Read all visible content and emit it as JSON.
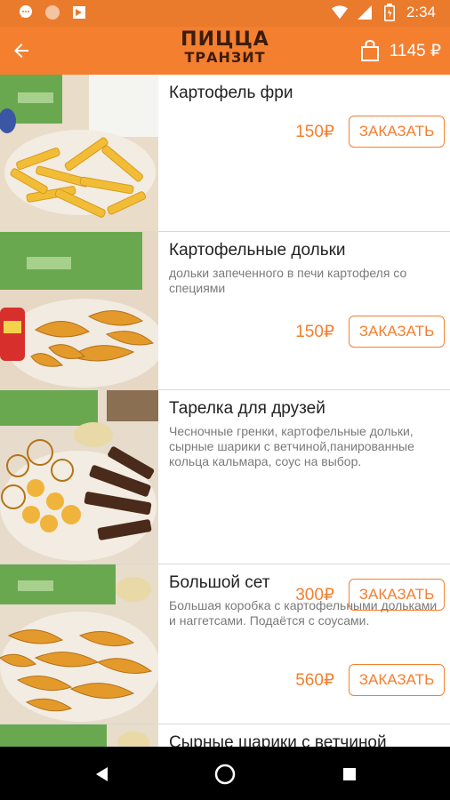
{
  "status_bar": {
    "time": "2:34",
    "left_icons": [
      "chat-icon",
      "circle-icon",
      "notification-icon"
    ],
    "right_icons": [
      "wifi-icon",
      "signal-icon",
      "battery-icon"
    ]
  },
  "app_bar": {
    "logo_line1": "ПИЦЦА",
    "logo_line2": "ТРАНЗИТ",
    "cart_total": "1145 ₽"
  },
  "colors": {
    "accent": "#f47f2f",
    "status_bar": "#ea7a2c",
    "logo_dark": "#3b1d0e"
  },
  "items": [
    {
      "title": "Картофель фри",
      "description": "",
      "price": "150₽",
      "order_label": "ЗАКАЗАТЬ"
    },
    {
      "title": "Картофельные дольки",
      "description": "дольки запеченного в печи  картофеля со специями",
      "price": "150₽",
      "order_label": "ЗАКАЗАТЬ"
    },
    {
      "title": "Тарелка для друзей",
      "description": "Чесночные гренки, картофельные дольки, сырные шарики с ветчиной,панированные кольца кальмара, соус на выбор.",
      "price": "300₽",
      "order_label": "ЗАКАЗАТЬ"
    },
    {
      "title": "Большой сет",
      "description": "Большая коробка с картофельными дольками и наггетсами. Подаётся с соусами.",
      "price": "560₽",
      "order_label": "ЗАКАЗАТЬ"
    },
    {
      "title": "Сырные шарики с ветчиной",
      "description": "",
      "price": "",
      "order_label": ""
    }
  ]
}
